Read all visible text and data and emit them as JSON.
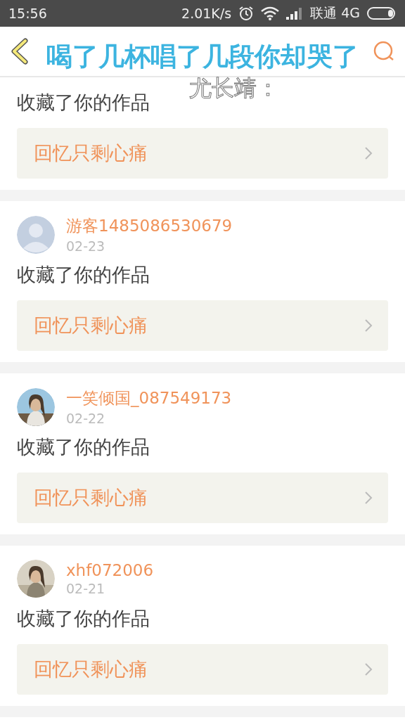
{
  "status_bar": {
    "time": "15:56",
    "speed": "2.01K/s",
    "carrier": "联通 4G"
  },
  "lyrics_overlay": {
    "line": "喝了几杯唱了几段你却哭了",
    "singer": "尤长靖："
  },
  "messages": [
    {
      "action": "收藏了你的作品",
      "work": "回忆只剩心痛"
    },
    {
      "user": "游客1485086530679",
      "date": "02-23",
      "avatar": {
        "kind": "default"
      },
      "action": "收藏了你的作品",
      "work": "回忆只剩心痛"
    },
    {
      "user": "一笑倾国_087549173",
      "date": "02-22",
      "action": "收藏了你的作品",
      "work": "回忆只剩心痛"
    },
    {
      "user": "xhf072006",
      "date": "02-21",
      "action": "收藏了你的作品",
      "work": "回忆只剩心痛"
    }
  ]
}
